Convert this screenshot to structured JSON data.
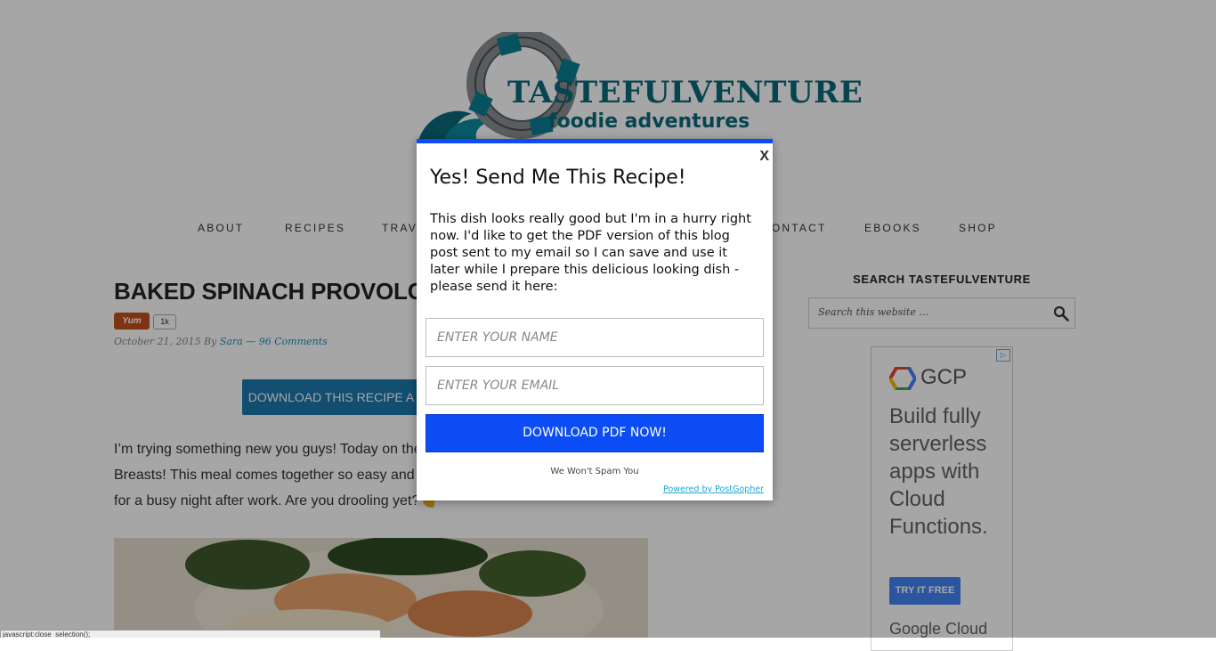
{
  "site": {
    "logo_title": "TASTEFULVENTURE",
    "logo_subtitle": "foodie adventures"
  },
  "nav": {
    "items": [
      "ABOUT",
      "RECIPES",
      "TRAVEL",
      "CONTACT",
      "EBOOKS",
      "SHOP"
    ]
  },
  "post": {
    "title": "BAKED SPINACH PROVOLONE",
    "yum_label": "Yum",
    "yum_count": "1k",
    "date": "October 21, 2015",
    "by": "By",
    "author": "Sara",
    "separator": "—",
    "comments": "96 Comments",
    "download_button": "DOWNLOAD THIS RECIPE A",
    "body_lines": [
      "I’m trying something new you guys! Today on the",
      "Breasts! This meal comes together so easy and",
      "for a busy night after work. Are you drooling yet?"
    ]
  },
  "sidebar": {
    "search_title": "SEARCH TASTEFULVENTURE",
    "search_placeholder": "Search this website …",
    "ad": {
      "brand": "GCP",
      "headline": "Build fully serverless apps with Cloud Functions.",
      "cta": "TRY IT FREE",
      "footer_brand": "Google Cloud",
      "choices_icon": "ad-choices-icon"
    }
  },
  "modal": {
    "close_label": "X",
    "title": "Yes! Send Me This Recipe!",
    "description": "This dish looks really good but I'm in a hurry right now. I'd like to get the PDF version of this blog post sent to my email so I can save and use it later while I prepare this delicious looking dish - please send it here:",
    "name_placeholder": "ENTER YOUR NAME",
    "email_placeholder": "ENTER YOUR EMAIL",
    "submit_label": "DOWNLOAD PDF NOW!",
    "nospam": "We Won't Spam You",
    "powered": "Powered by PostGopher"
  },
  "statusbar": {
    "text": "javascript:close_selection();"
  },
  "colors": {
    "accent_blue": "#0b4cf4",
    "logo_teal": "#0a6a7c",
    "link_blue": "#1a8fbd",
    "ad_blue": "#4285f4"
  }
}
